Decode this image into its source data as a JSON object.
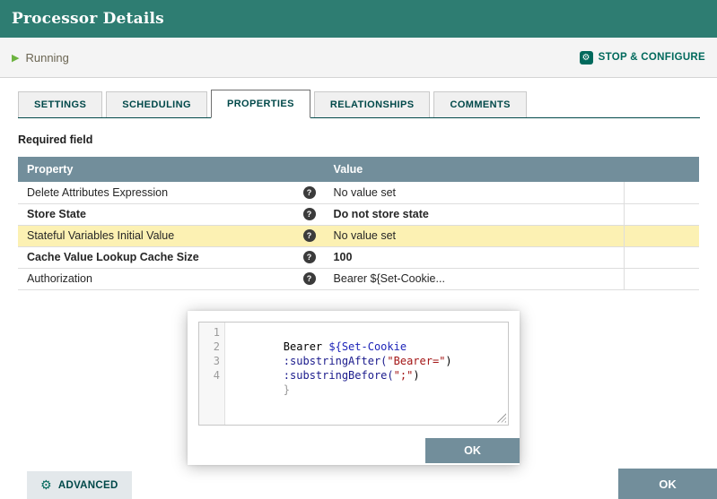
{
  "window": {
    "title": "Processor Details"
  },
  "status_bar": {
    "run_state": "Running",
    "stop_configure_label": "STOP &amp; CONFIGURE"
  },
  "tabs": [
    {
      "label": "SETTINGS",
      "active": false
    },
    {
      "label": "SCHEDULING",
      "active": false
    },
    {
      "label": "PROPERTIES",
      "active": true
    },
    {
      "label": "RELATIONSHIPS",
      "active": false
    },
    {
      "label": "COMMENTS",
      "active": false
    }
  ],
  "properties_tab": {
    "required_field_label": "Required field",
    "table": {
      "headers": {
        "property": "Property",
        "value": "Value"
      },
      "rows": [
        {
          "property": "Delete Attributes Expression",
          "value": "No value set",
          "value_state": "unset",
          "emphasis": false,
          "highlighted": false
        },
        {
          "property": "Store State",
          "value": "Do not store state",
          "value_state": "set",
          "emphasis": true,
          "highlighted": false
        },
        {
          "property": "Stateful Variables Initial Value",
          "value": "No value set",
          "value_state": "unset",
          "emphasis": false,
          "highlighted": true
        },
        {
          "property": "Cache Value Lookup Cache Size",
          "value": "100",
          "value_state": "set",
          "emphasis": true,
          "highlighted": false
        },
        {
          "property": "Authorization",
          "value": "Bearer ${Set-Cookie...",
          "value_state": "set",
          "emphasis": false,
          "highlighted": false
        }
      ]
    }
  },
  "value_editor_popup": {
    "lines": [
      {
        "num": "1",
        "plain": "Bearer ",
        "expression": "${Set-Cookie"
      },
      {
        "num": "2",
        "function": ":substringAfter(",
        "string": "\"Bearer=\"",
        "close": ")"
      },
      {
        "num": "3",
        "function": ":substringBefore(",
        "string": "\";\"",
        "close": ")"
      },
      {
        "num": "4",
        "bracket": "}"
      }
    ],
    "ok_label": "OK"
  },
  "footer": {
    "advanced_label": "ADVANCED",
    "ok_label": "OK"
  },
  "icons": {
    "play": "▶",
    "gear": "⚙",
    "help": "?"
  },
  "colors": {
    "header_background": "#2E7D72",
    "running_green": "#6CB33F",
    "action_teal": "#00695C",
    "table_header_background": "#728E9B",
    "highlight_row": "#FCF1B3",
    "button_background": "#728E9B",
    "tab_text": "#004849"
  }
}
